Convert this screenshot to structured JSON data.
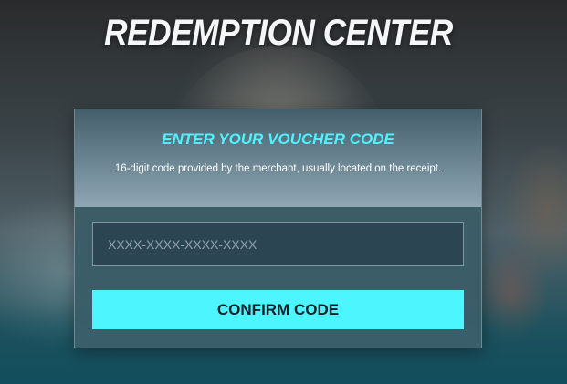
{
  "page": {
    "title": "REDEMPTION CENTER"
  },
  "voucher": {
    "heading": "ENTER YOUR VOUCHER CODE",
    "description": "16-digit code provided by the merchant, usually located on the receipt.",
    "input_value": "",
    "input_placeholder": "XXXX-XXXX-XXXX-XXXX",
    "confirm_label": "CONFIRM CODE"
  },
  "colors": {
    "accent": "#4df5ff",
    "heading": "#4ef3ff",
    "panel": "#3c5c66",
    "input_bg": "#2c4553"
  }
}
